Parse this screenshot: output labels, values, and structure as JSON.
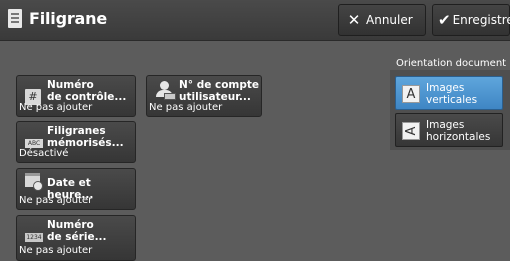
{
  "header": {
    "title": "Filigrane",
    "cancel_label": "Annuler",
    "save_label": "Enregistrer"
  },
  "options": [
    {
      "label_line1": "Numéro",
      "label_line2": "de contrôle...",
      "status": "Ne pas ajouter",
      "icon": "hash-icon"
    },
    {
      "label_line1": "N° de compte",
      "label_line2": "utilisateur...",
      "status": "Ne pas ajouter",
      "icon": "user-account-icon"
    },
    {
      "label_line1": "Filigranes",
      "label_line2": "mémorisés...",
      "status": "Désactivé",
      "icon": "abc-watermark-icon",
      "icon_text": "ABC"
    },
    {
      "label_line1": "Date et heure...",
      "status": "Ne pas ajouter",
      "icon": "calendar-clock-icon"
    },
    {
      "label_line1": "Numéro",
      "label_line2": "de série...",
      "status": "Ne pas ajouter",
      "icon": "serial-number-icon",
      "icon_text": "1234"
    }
  ],
  "orientation": {
    "heading": "Orientation document",
    "choices": [
      {
        "line1": "Images",
        "line2": "verticales",
        "glyph": "A",
        "selected": true
      },
      {
        "line1": "Images",
        "line2": "horizontales",
        "glyph": "A",
        "selected": false
      }
    ]
  },
  "colors": {
    "background": "#5c5c5c",
    "accent_selected": "#4a94d0"
  }
}
